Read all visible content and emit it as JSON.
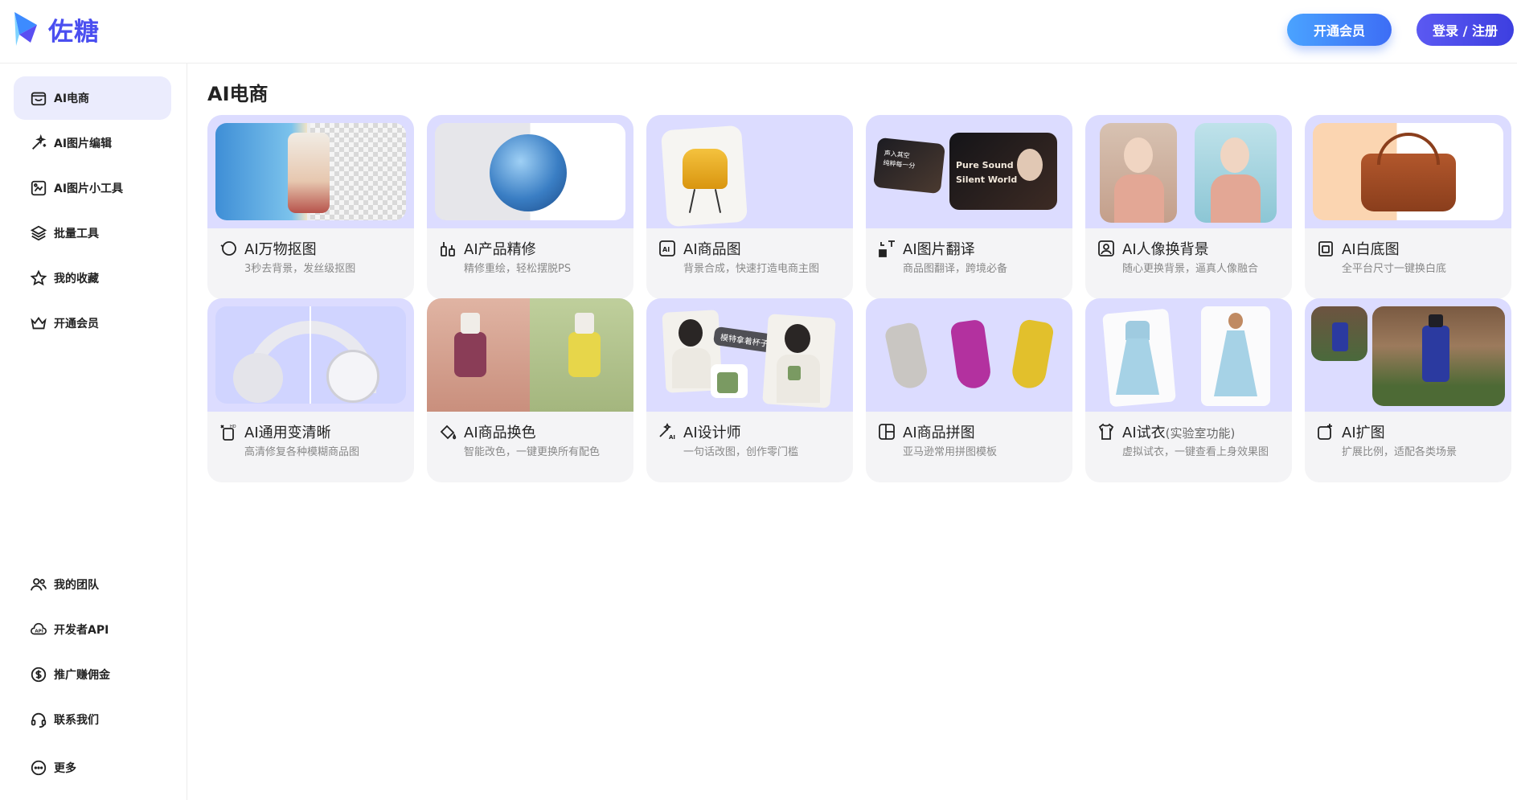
{
  "brand": {
    "name": "佐糖"
  },
  "header": {
    "vip_button": "开通会员",
    "login_button": "登录 / 注册"
  },
  "sidebar": {
    "top_items": [
      {
        "label": "AI电商",
        "icon": "store-icon",
        "active": true
      },
      {
        "label": "AI图片编辑",
        "icon": "magic-wand-icon"
      },
      {
        "label": "AI图片小工具",
        "icon": "image-tool-icon"
      },
      {
        "label": "批量工具",
        "icon": "layers-icon"
      },
      {
        "label": "我的收藏",
        "icon": "star-icon"
      },
      {
        "label": "开通会员",
        "icon": "crown-icon"
      }
    ],
    "bottom_items": [
      {
        "label": "我的团队",
        "icon": "team-icon"
      },
      {
        "label": "开发者API",
        "icon": "api-icon"
      },
      {
        "label": "推广赚佣金",
        "icon": "dollar-icon"
      },
      {
        "label": "联系我们",
        "icon": "headset-icon"
      },
      {
        "label": "更多",
        "icon": "more-icon"
      }
    ]
  },
  "main": {
    "title": "AI电商",
    "cards": [
      {
        "title": "AI万物抠图",
        "desc": "3秒去背景，发丝级抠图",
        "icon": "cutout-icon"
      },
      {
        "title": "AI产品精修",
        "desc": "精修重绘，轻松摆脱PS",
        "icon": "retouch-icon"
      },
      {
        "title": "AI商品图",
        "desc": "背景合成，快速打造电商主图",
        "icon": "ai-image-icon"
      },
      {
        "title": "AI图片翻译",
        "desc": "商品图翻译，跨境必备",
        "icon": "translate-icon",
        "overlay": [
          "声入其空",
          "纯粹每一分",
          "Pure Sound",
          "Silent World"
        ]
      },
      {
        "title": "AI人像换背景",
        "desc": "随心更换背景，逼真人像融合",
        "icon": "portrait-bg-icon"
      },
      {
        "title": "AI白底图",
        "desc": "全平台尺寸一键换白底",
        "icon": "white-bg-icon"
      },
      {
        "title": "AI通用变清晰",
        "desc": "高清修复各种模糊商品图",
        "icon": "hd-icon"
      },
      {
        "title": "AI商品换色",
        "desc": "智能改色，一键更换所有配色",
        "icon": "paint-bucket-icon"
      },
      {
        "title": "AI设计师",
        "desc": "一句话改图，创作零门槛",
        "icon": "ai-designer-icon",
        "overlay": [
          "模特拿着杯子"
        ]
      },
      {
        "title": "AI商品拼图",
        "desc": "亚马逊常用拼图模板",
        "icon": "collage-icon"
      },
      {
        "title": "AI试衣",
        "title_suffix": "(实验室功能)",
        "desc": "虚拟试衣，一键查看上身效果图",
        "icon": "tryon-icon"
      },
      {
        "title": "AI扩图",
        "desc": "扩展比例，适配各类场景",
        "icon": "expand-icon"
      }
    ]
  }
}
